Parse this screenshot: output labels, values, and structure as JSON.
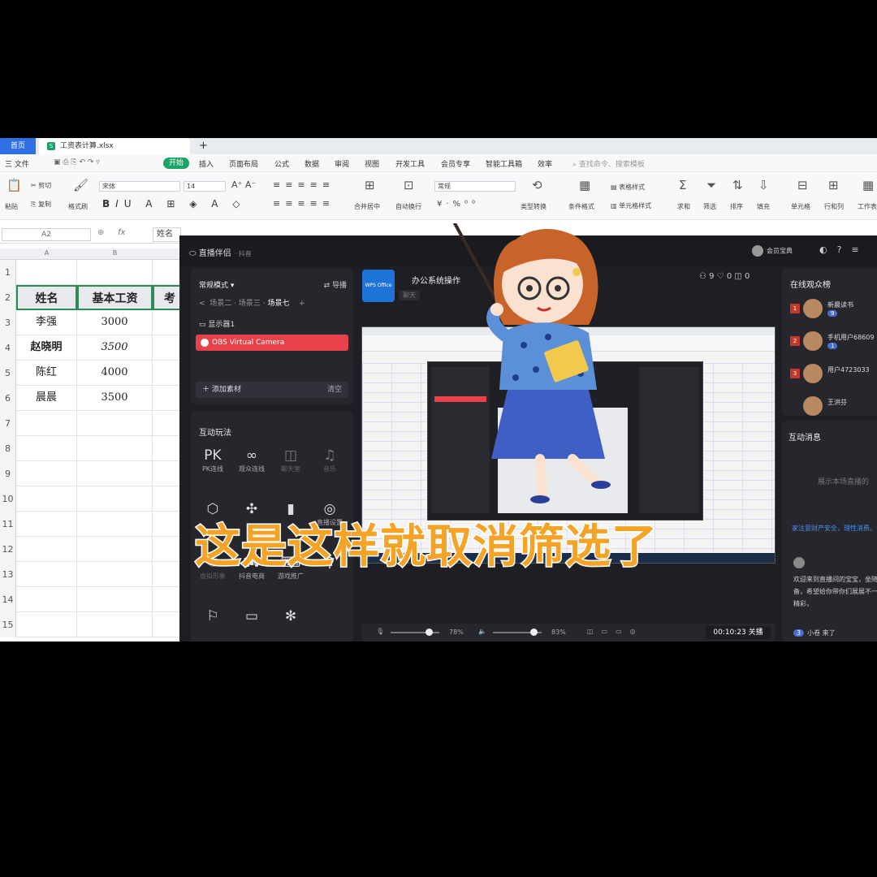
{
  "wps": {
    "tabs": {
      "home": "首页",
      "file": "工资表计算.xlsx"
    },
    "menu": {
      "file": "三 文件",
      "items": [
        "插入",
        "页面布局",
        "公式",
        "数据",
        "审阅",
        "视图",
        "开发工具",
        "会员专享",
        "智能工具箱",
        "效率"
      ],
      "active": "开始",
      "search": "查找命令、搜索模板"
    },
    "ribbon": {
      "paste": "粘贴",
      "cut": "剪切",
      "copy": "复制",
      "format_painter": "格式刷",
      "font": "宋体",
      "size": "14",
      "merge": "合并居中",
      "wrap": "自动换行",
      "number_format": "常规",
      "type_convert": "类型转换",
      "conditional": "条件格式",
      "table_style": "表格样式",
      "cell_style": "单元格样式",
      "sum": "求和",
      "filter": "筛选",
      "sort": "排序",
      "fill": "填充",
      "cell": "单元格",
      "rowcol": "行和列",
      "worksheet": "工作表"
    },
    "cell_ref": "A2",
    "formula_value": "姓名",
    "columns": [
      "A",
      "B"
    ],
    "rows": [
      "1",
      "2",
      "3",
      "4",
      "5",
      "6",
      "7",
      "8",
      "9",
      "10",
      "11",
      "12",
      "13",
      "14",
      "15"
    ],
    "table": {
      "headers": [
        "姓名",
        "基本工资",
        "考"
      ],
      "data": [
        [
          "李强",
          "3000"
        ],
        [
          "赵晓明",
          "3500"
        ],
        [
          "陈红",
          "4000"
        ],
        [
          "晨晨",
          "3500"
        ]
      ]
    }
  },
  "live": {
    "app_name": "直播伴侣",
    "app_sub": "· 抖音",
    "user": "会员宝典",
    "scene_mode": "常规模式 ▾",
    "import": "导播",
    "scene_tabs": [
      "场景二",
      "场景三",
      "场景七"
    ],
    "source_monitor": "显示器1",
    "source_obs": "OBS Virtual Camera",
    "add_source": "添加素材",
    "clear": "清空",
    "tools_title": "互动玩法",
    "tools": [
      {
        "icon": "PK",
        "label": "PK连线"
      },
      {
        "icon": "∞",
        "label": "观众连线"
      },
      {
        "icon": "◫",
        "label": "聊天室"
      },
      {
        "icon": "♫",
        "label": "音乐"
      },
      {
        "icon": "⬡",
        "label": ""
      },
      {
        "icon": "✣",
        "label": ""
      },
      {
        "icon": "▮",
        "label": ""
      },
      {
        "icon": "◎",
        "label": "直播设置"
      },
      {
        "icon": "⚇",
        "label": "虚拟形象"
      },
      {
        "icon": "⛟",
        "label": "抖音电商"
      },
      {
        "icon": "⌨",
        "label": "游戏推广"
      },
      {
        "icon": "⚲",
        "label": ""
      },
      {
        "icon": "⚐",
        "label": ""
      },
      {
        "icon": "▭",
        "label": ""
      },
      {
        "icon": "✻",
        "label": ""
      }
    ],
    "room_icon": "WPS Office",
    "room_title": "办公系统操作",
    "room_tag": "聊天",
    "stats": "⚇ 9   ♡ 0   ◫ 0",
    "mic_percent": "78%",
    "speaker_percent": "83%",
    "mic_level": 0.78,
    "speaker_level": 0.83,
    "timer": "00:10:23 关播",
    "rank_title": "在线观众榜",
    "rank": [
      {
        "num": "1",
        "name": "新晨读书",
        "badge": "9"
      },
      {
        "num": "2",
        "name": "手机用户68609",
        "badge": "1"
      },
      {
        "num": "3",
        "name": "用户4723033",
        "badge": ""
      },
      {
        "num": "",
        "name": "王洪芬",
        "badge": ""
      }
    ],
    "msg_title": "互动消息",
    "msg_empty": "展示本场直播的",
    "msg_warn": "家注意财产安全，理性消费。",
    "msg_bubble": "欢迎来到直播间的宝宝，坐随心准备，希望给你带你们展展不一样的精彩，",
    "msg_arrive_badge": "3",
    "msg_arrive": "小卷 来了"
  },
  "caption": "这是这样就取消筛选了",
  "colors": {
    "wps_green": "#1aa567",
    "wps_blue": "#2f6fe4",
    "live_bg": "#1e1f24",
    "obs_red": "#e8414a",
    "caption_orange": "#f5a326"
  }
}
